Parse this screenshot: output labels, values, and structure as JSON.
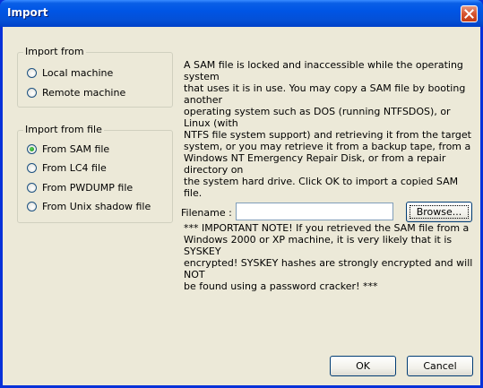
{
  "window": {
    "title": "Import"
  },
  "import_from": {
    "title": "Import from",
    "options": [
      {
        "label": "Local machine",
        "checked": false
      },
      {
        "label": "Remote machine",
        "checked": false
      }
    ]
  },
  "import_from_file": {
    "title": "Import from file",
    "options": [
      {
        "label": "From SAM file",
        "checked": true
      },
      {
        "label": "From LC4 file",
        "checked": false
      },
      {
        "label": "From PWDUMP file",
        "checked": false
      },
      {
        "label": "From Unix shadow file",
        "checked": false
      }
    ]
  },
  "info": {
    "paragraph1": "A SAM file is locked and inaccessible while the operating system\nthat uses it is in use. You may copy a SAM file by booting another\noperating system such as DOS (running NTFSDOS), or Linux (with\nNTFS file system support) and retrieving it from the target\nsystem, or you may retrieve it from a backup tape, from a\nWindows NT Emergency Repair Disk, or from a repair directory on\nthe system hard drive. Click OK to import a copied SAM file.",
    "paragraph2": "*** IMPORTANT NOTE! If you retrieved the SAM file from a\nWindows 2000 or XP machine, it is very likely that it is SYSKEY\nencrypted!  SYSKEY hashes are strongly encrypted and will NOT\nbe found using a password cracker! ***"
  },
  "filename": {
    "label": "Filename :",
    "value": ""
  },
  "buttons": {
    "browse": "Browse...",
    "ok": "OK",
    "cancel": "Cancel"
  },
  "colors": {
    "titlebar": "#0055e5",
    "dialog_bg": "#ece9d8",
    "radio_dot": "#21a121",
    "close_button": "#d6542f"
  }
}
